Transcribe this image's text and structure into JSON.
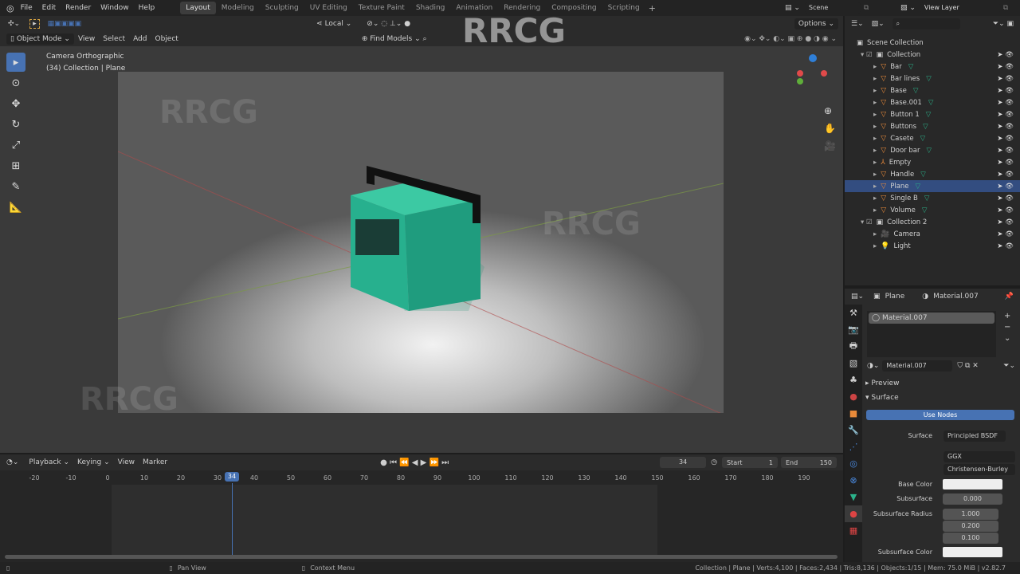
{
  "menu": [
    "File",
    "Edit",
    "Render",
    "Window",
    "Help"
  ],
  "workspaces": [
    "Layout",
    "Modeling",
    "Sculpting",
    "UV Editing",
    "Texture Paint",
    "Shading",
    "Animation",
    "Rendering",
    "Compositing",
    "Scripting"
  ],
  "scene": "Scene",
  "view_layer": "View Layer",
  "toolhdr": {
    "pivot": "Local",
    "options": "Options"
  },
  "vphdr": {
    "mode": "Object Mode",
    "view": "View",
    "select": "Select",
    "add": "Add",
    "object": "Object",
    "find_models": "Find Models"
  },
  "viewport": {
    "camera_label": "Camera Orthographic",
    "collection_label": "(34) Collection | Plane"
  },
  "outliner": {
    "root": "Scene Collection",
    "items": [
      {
        "name": "Collection",
        "type": "collection",
        "level": 1
      },
      {
        "name": "Bar",
        "type": "mesh",
        "level": 2
      },
      {
        "name": "Bar lines",
        "type": "mesh",
        "level": 2
      },
      {
        "name": "Base",
        "type": "mesh",
        "level": 2
      },
      {
        "name": "Base.001",
        "type": "mesh",
        "level": 2
      },
      {
        "name": "Button 1",
        "type": "mesh",
        "level": 2
      },
      {
        "name": "Buttons",
        "type": "mesh",
        "level": 2
      },
      {
        "name": "Casete",
        "type": "mesh",
        "level": 2
      },
      {
        "name": "Door bar",
        "type": "mesh",
        "level": 2
      },
      {
        "name": "Empty",
        "type": "empty",
        "level": 2
      },
      {
        "name": "Handle",
        "type": "mesh",
        "level": 2
      },
      {
        "name": "Plane",
        "type": "mesh",
        "level": 2,
        "selected": true
      },
      {
        "name": "Single B",
        "type": "mesh",
        "level": 2
      },
      {
        "name": "Volume",
        "type": "mesh",
        "level": 2
      },
      {
        "name": "Collection 2",
        "type": "collection",
        "level": 1
      },
      {
        "name": "Camera",
        "type": "camera",
        "level": 2
      },
      {
        "name": "Light",
        "type": "light",
        "level": 2
      }
    ]
  },
  "props": {
    "object": "Plane",
    "material": "Material.007",
    "slot": "Material.007",
    "preview": "Preview",
    "surface_panel": "Surface",
    "use_nodes": "Use Nodes",
    "fields": {
      "surface_label": "Surface",
      "surface": "Principled BSDF",
      "distribution": "GGX",
      "subsurface_method": "Christensen-Burley",
      "base_color_label": "Base Color",
      "subsurface_label": "Subsurface",
      "subsurface": "0.000",
      "radius_label": "Subsurface Radius",
      "radius": [
        "1.000",
        "0.200",
        "0.100"
      ],
      "subsurface_color_label": "Subsurface Color"
    }
  },
  "timeline": {
    "playback": "Playback",
    "keying": "Keying",
    "view": "View",
    "marker": "Marker",
    "current": "34",
    "start_label": "Start",
    "start": "1",
    "end_label": "End",
    "end": "150",
    "ticks": [
      "-20",
      "-10",
      "0",
      "10",
      "20",
      "30",
      "40",
      "50",
      "60",
      "70",
      "80",
      "90",
      "100",
      "110",
      "120",
      "130",
      "140",
      "150",
      "160",
      "170",
      "180",
      "190"
    ]
  },
  "status": {
    "left": "Pan View",
    "mid": "Context Menu",
    "right": "Collection | Plane | Verts:4,100 | Faces:2,434 | Tris:8,136 | Objects:1/15 | Mem: 75.0 MiB | v2.82.7"
  },
  "watermark": "RRCG",
  "colors": {
    "accent": "#4772b3",
    "selection": "#334d80",
    "mesh": "#e88a3a",
    "modifier": "#2bb28a"
  }
}
